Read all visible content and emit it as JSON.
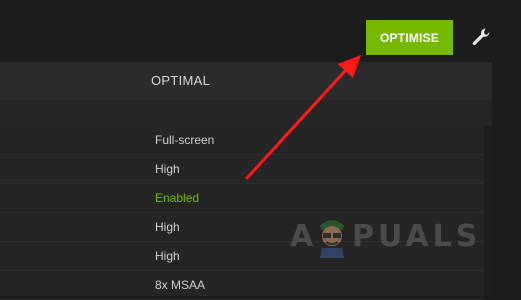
{
  "toolbar": {
    "optimise_label": "OPTIMISE",
    "settings_icon": "wrench-icon"
  },
  "table": {
    "column_header": "OPTIMAL",
    "rows": [
      {
        "value": "Full-screen",
        "status": "normal"
      },
      {
        "value": "High",
        "status": "normal"
      },
      {
        "value": "Enabled",
        "status": "enabled"
      },
      {
        "value": "High",
        "status": "normal"
      },
      {
        "value": "High",
        "status": "normal"
      },
      {
        "value": "8x MSAA",
        "status": "normal"
      }
    ]
  },
  "annotation": {
    "arrow_icon": "red-arrow-icon",
    "arrow_color": "#ff1a1a"
  },
  "watermark": {
    "text_left": "A",
    "text_right": "PUALS",
    "icon": "appuals-mascot-icon"
  },
  "colors": {
    "accent": "#76b900",
    "background": "#1c1c1c",
    "text": "#cfcfcf"
  }
}
